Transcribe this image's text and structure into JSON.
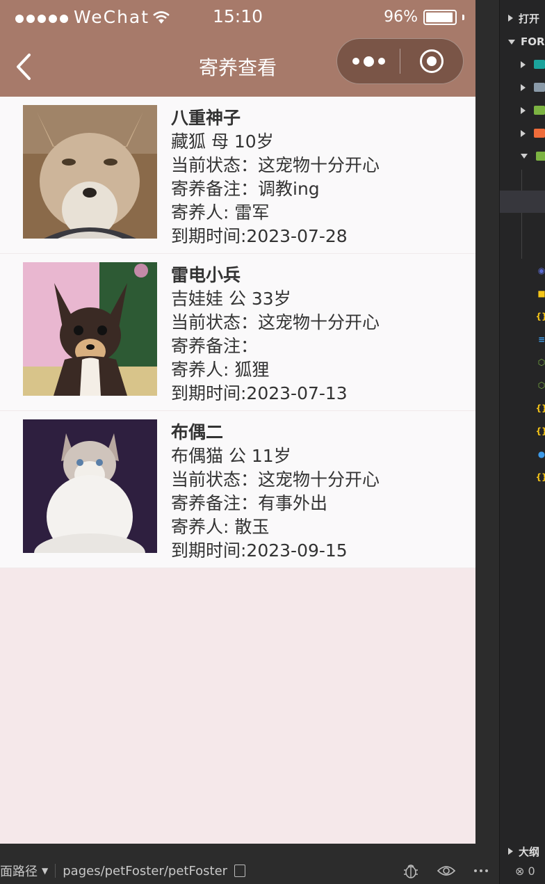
{
  "status_bar": {
    "carrier": "WeChat",
    "time": "15:10",
    "battery": "96%",
    "battery_level": 0.96
  },
  "nav": {
    "title": "寄养查看"
  },
  "fosters": [
    {
      "name": "八重神子",
      "breed_info": "藏狐 母 10岁",
      "status": "当前状态：这宠物十分开心",
      "note": "寄养备注：调教ing",
      "owner": "寄养人: 雷军",
      "expire": "到期时间:2023-07-28",
      "image": "tibetan-fox-photo"
    },
    {
      "name": "雷电小兵",
      "breed_info": "吉娃娃 公 33岁",
      "status": "当前状态：这宠物十分开心",
      "note": "寄养备注：",
      "owner": "寄养人: 狐狸",
      "expire": "到期时间:2023-07-13",
      "image": "chihuahua-photo"
    },
    {
      "name": "布偶二",
      "breed_info": "布偶猫 公 11岁",
      "status": "当前状态：这宠物十分开心",
      "note": "寄养备注：有事外出",
      "owner": "寄养人: 散玉",
      "expire": "到期时间:2023-09-15",
      "image": "ragdoll-cat-photo"
    }
  ],
  "devtools": {
    "path_label": "面路径",
    "path_value": "pages/petFoster/petFoster"
  },
  "explorer": {
    "open_editors_label": "打开",
    "project_label": "FORC",
    "outline_label": "大纲",
    "error_count": "0"
  },
  "colors": {
    "nav_bg": "#a77a6a",
    "page_bg": "#f5e8ea",
    "card_bg": "#faf9fa"
  }
}
